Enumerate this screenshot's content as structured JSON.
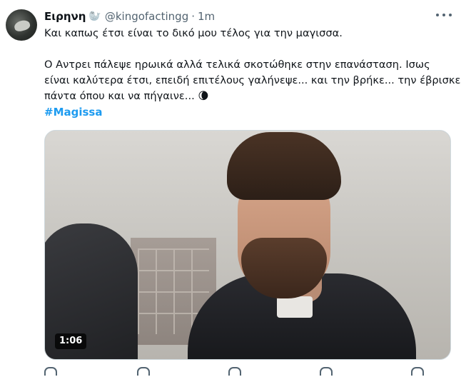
{
  "tweet": {
    "author_name": "Ειρηνη",
    "author_badge_icon": "seal-emoji-icon",
    "handle": "@kingofactingg",
    "separator": "·",
    "time": "1m",
    "line1": "Και καπως έτσι είναι το δικό μου τέλος για την μαγισσα.",
    "line2": "Ο Αντρει πάλεψε ηρωικά αλλά τελικά σκοτώθηκε στην επανάσταση. Ισως",
    "line3": "είναι καλύτερα έτσι, επειδή επιτέλους γαλήνεψε... και την βρήκε... την έβρισκε",
    "line4": "πάντα όπου και να πήγαινε...",
    "moon_emoji": "🌘",
    "hashtag": "#Magissa"
  },
  "media": {
    "duration": "1:06"
  },
  "colors": {
    "link": "#1d9bf0",
    "secondary_text": "#536471",
    "text": "#0f1419"
  }
}
